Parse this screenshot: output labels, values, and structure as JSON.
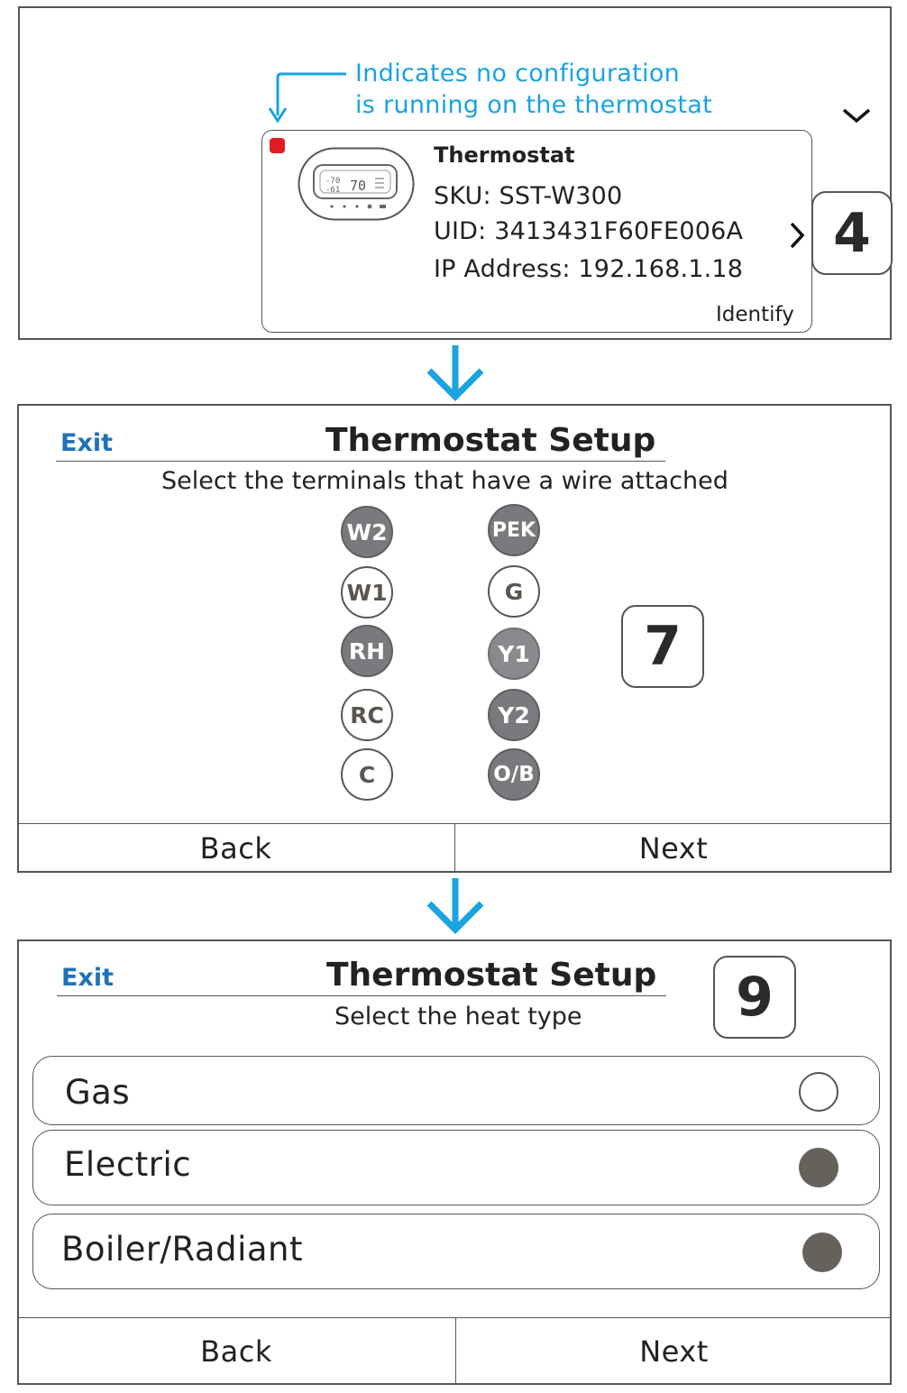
{
  "screen1": {
    "annotation_line1": "Indicates no configuration",
    "annotation_line2": "is running on the thermostat",
    "dropdown_icon": "chevron-down-icon",
    "device": {
      "name": "Thermostat",
      "sku": "SKU: SST-W300",
      "uid": "UID: 3413431F60FE006A",
      "ip": "IP Address: 192.168.1.18",
      "status_color": "#e31b23",
      "identify_label": "Identify"
    },
    "step": "4"
  },
  "screen2": {
    "exit_label": "Exit",
    "title": "Thermostat Setup",
    "subtitle": "Select the terminals that have a wire attached",
    "terminals_left": [
      {
        "label": "W2",
        "selected": true
      },
      {
        "label": "W1",
        "selected": false
      },
      {
        "label": "RH",
        "selected": true
      },
      {
        "label": "RC",
        "selected": false
      },
      {
        "label": "C",
        "selected": false
      }
    ],
    "terminals_right": [
      {
        "label": "PEK",
        "selected": true
      },
      {
        "label": "G",
        "selected": false
      },
      {
        "label": "Y1",
        "selected": true
      },
      {
        "label": "Y2",
        "selected": true
      },
      {
        "label": "O/B",
        "selected": true
      }
    ],
    "back_label": "Back",
    "next_label": "Next",
    "step": "7"
  },
  "screen3": {
    "exit_label": "Exit",
    "title": "Thermostat Setup",
    "subtitle": "Select the heat type",
    "options": [
      {
        "label": "Gas",
        "selected": false
      },
      {
        "label": "Electric",
        "selected": true
      },
      {
        "label": "Boiler/Radiant",
        "selected": true
      }
    ],
    "back_label": "Back",
    "next_label": "Next",
    "step": "9"
  },
  "colors": {
    "accent_blue": "#1aa3e0",
    "exit_blue": "#1f72b8",
    "terminal_selected": "#7a7a7e",
    "radio_filled": "#67615b"
  }
}
